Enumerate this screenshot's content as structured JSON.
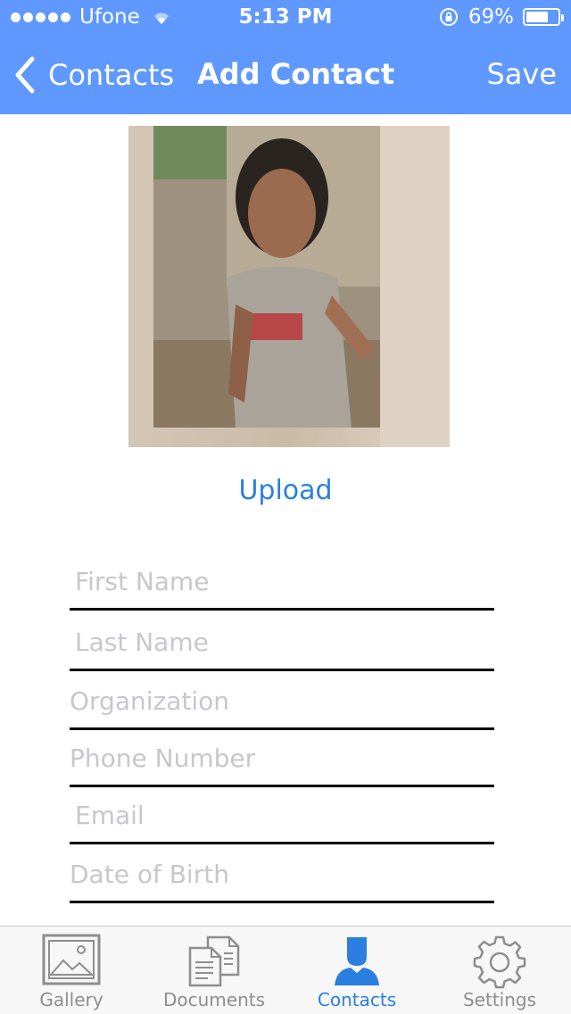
{
  "status_bar": {
    "carrier": "Ufone",
    "time": "5:13 PM",
    "battery": "69%"
  },
  "nav": {
    "back_label": "Contacts",
    "title": "Add Contact",
    "save_label": "Save"
  },
  "photo": {
    "upload_label": "Upload"
  },
  "fields": [
    {
      "placeholder": "First Name",
      "value": ""
    },
    {
      "placeholder": "Last Name",
      "value": ""
    },
    {
      "placeholder": "Organization",
      "value": ""
    },
    {
      "placeholder": "Phone Number",
      "value": ""
    },
    {
      "placeholder": "Email",
      "value": ""
    },
    {
      "placeholder": "Date of Birth",
      "value": ""
    }
  ],
  "tabbar": {
    "tabs": [
      {
        "label": "Gallery",
        "icon": "gallery-icon"
      },
      {
        "label": "Documents",
        "icon": "documents-icon"
      },
      {
        "label": "Contacts",
        "icon": "contacts-icon",
        "active": true
      },
      {
        "label": "Settings",
        "icon": "settings-icon"
      }
    ]
  },
  "colors": {
    "nav_bar": "#5f98ff",
    "accent": "#2b7fe0",
    "placeholder": "#c7c7cd",
    "tab_inactive": "#8e8e8e"
  }
}
